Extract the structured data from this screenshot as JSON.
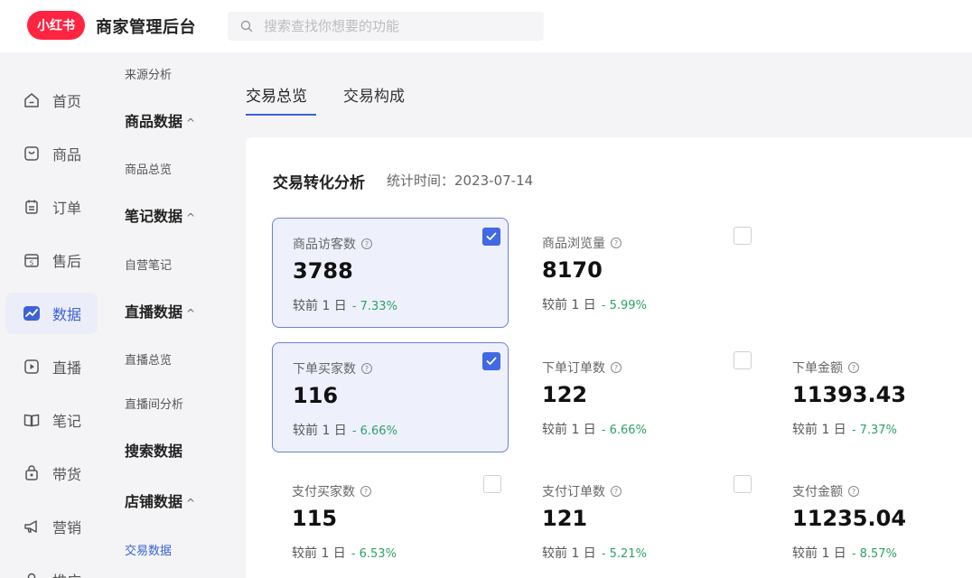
{
  "header": {
    "logo_text": "小红书",
    "title": "商家管理后台",
    "search_placeholder": "搜索查找你想要的功能"
  },
  "leftnav": [
    {
      "label": "首页",
      "icon": "home-icon"
    },
    {
      "label": "商品",
      "icon": "product-icon"
    },
    {
      "label": "订单",
      "icon": "order-icon"
    },
    {
      "label": "售后",
      "icon": "after-sales-icon"
    },
    {
      "label": "数据",
      "icon": "data-icon",
      "active": true
    },
    {
      "label": "直播",
      "icon": "live-icon"
    },
    {
      "label": "笔记",
      "icon": "notes-icon"
    },
    {
      "label": "带货",
      "icon": "bag-icon"
    },
    {
      "label": "营销",
      "icon": "megaphone-icon"
    },
    {
      "label": "推广",
      "icon": "promote-icon"
    }
  ],
  "subnav": {
    "source_analysis": "来源分析",
    "goods_data": "商品数据",
    "goods_overview": "商品总览",
    "notes_data": "笔记数据",
    "self_notes": "自营笔记",
    "live_data": "直播数据",
    "live_overview": "直播总览",
    "live_room_analysis": "直播间分析",
    "search_data": "搜索数据",
    "shop_data": "店铺数据",
    "trade_data": "交易数据",
    "caret": "^"
  },
  "tabs": [
    "交易总览",
    "交易构成"
  ],
  "panel": {
    "title": "交易转化分析",
    "time_label": "统计时间：2023-07-14"
  },
  "compare_prefix": "较前 1 日",
  "cards": [
    {
      "label": "商品访客数",
      "value": "3788",
      "pct": "- 7.33%",
      "checked": true
    },
    {
      "label": "商品浏览量",
      "value": "8170",
      "pct": "- 5.99%",
      "checked": false
    },
    {
      "label": "下单买家数",
      "value": "116",
      "pct": "- 6.66%",
      "checked": true
    },
    {
      "label": "下单订单数",
      "value": "122",
      "pct": "- 6.66%",
      "checked": false
    },
    {
      "label": "下单金额",
      "value": "11393.43",
      "pct": "- 7.37%"
    },
    {
      "label": "支付买家数",
      "value": "115",
      "pct": "- 6.53%",
      "checked": false
    },
    {
      "label": "支付订单数",
      "value": "121",
      "pct": "- 5.21%",
      "checked": false
    },
    {
      "label": "支付金额",
      "value": "11235.04",
      "pct": "- 8.57%"
    }
  ],
  "colors": {
    "brand": "#ff2442",
    "accent": "#3c62d6",
    "positive": "#2ea266"
  }
}
